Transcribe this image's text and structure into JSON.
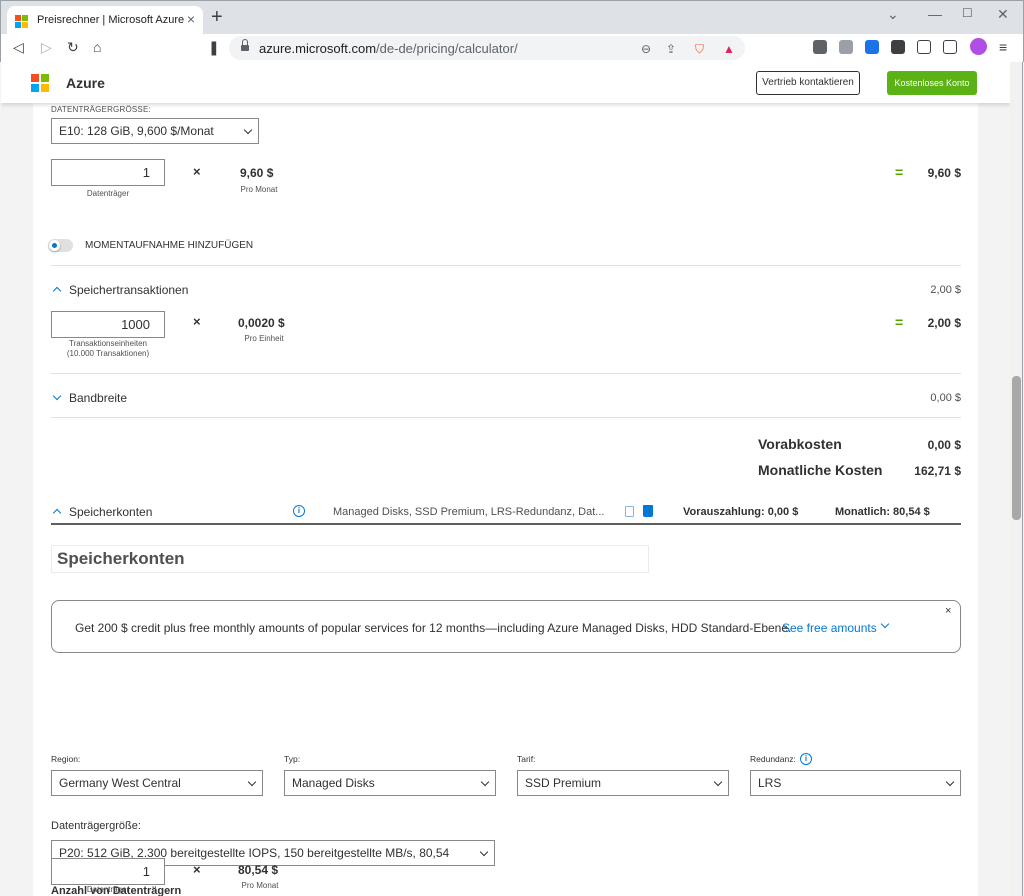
{
  "browser": {
    "tab_title": "Preisrechner | Microsoft Azure",
    "url_host": "azure.microsoft.com",
    "url_path": "/de-de/pricing/calculator/"
  },
  "header": {
    "brand": "Azure",
    "contact_label": "Vertrieb kontaktieren",
    "free_account_label": "Kostenloses Konto"
  },
  "disk_size": {
    "label": "DATENTRÄGERGRÖSSE:",
    "selected": "E10: 128 GiB, 9,600 $/Monat",
    "quantity": "1",
    "quantity_label": "Datenträger",
    "unit_price": "9,60 $",
    "unit_label": "Pro Monat",
    "total": "9,60 $"
  },
  "snapshot": {
    "label": "MOMENTAUFNAHME HINZUFÜGEN"
  },
  "transactions": {
    "title": "Speichertransaktionen",
    "summary": "2,00 $",
    "quantity": "1000",
    "quantity_label_line1": "Transaktionseinheiten",
    "quantity_label_line2": "(10.000 Transaktionen)",
    "unit_price": "0,0020 $",
    "unit_label": "Pro Einheit",
    "total": "2,00 $"
  },
  "bandwidth": {
    "title": "Bandbreite",
    "summary": "0,00 $"
  },
  "totals": {
    "upfront_label": "Vorabkosten",
    "upfront_value": "0,00 $",
    "monthly_label": "Monatliche Kosten",
    "monthly_value": "162,71 $"
  },
  "storage_accounts": {
    "title": "Speicherkonten",
    "summary": "Managed Disks, SSD Premium, LRS-Redundanz, Dat...",
    "upfront": "Vorauszahlung: 0,00 $",
    "monthly": "Monatlich: 80,54 $",
    "name_value": "Speicherkonten"
  },
  "banner": {
    "text": "Get 200 $ credit plus free monthly amounts of popular services for 12 months—including Azure Managed Disks, HDD Standard-Ebene.",
    "link": "See free amounts",
    "close": "×"
  },
  "filters": {
    "region_label": "Region:",
    "region_value": "Germany West Central",
    "type_label": "Typ:",
    "type_value": "Managed Disks",
    "tier_label": "Tarif:",
    "tier_value": "SSD Premium",
    "redundancy_label": "Redundanz:",
    "redundancy_value": "LRS"
  },
  "disk_size2": {
    "label": "Datenträgergröße:",
    "selected": "P20: 512 GiB, 2.300 bereitgestellte IOPS, 150 bereitgestellte MB/s, 80,54",
    "count_label": "Anzahl von Datenträgern",
    "quantity": "1",
    "quantity_label": "Datenträger",
    "unit_price": "80,54 $",
    "unit_label": "Pro Monat"
  },
  "colors": {
    "accent": "#0078d4",
    "green": "#5bb214",
    "equals": "#57a300"
  }
}
